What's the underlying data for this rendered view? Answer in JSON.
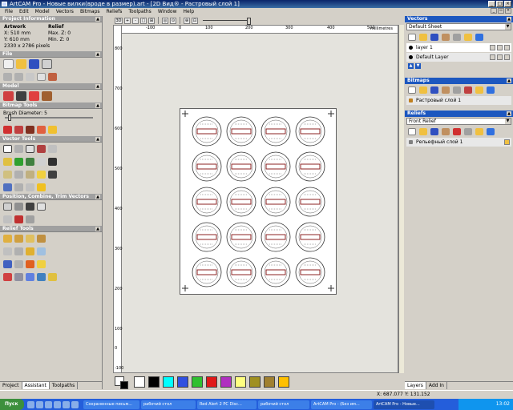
{
  "window": {
    "title": "ArtCAM Pro - Новые вилки(вроде в размер).art - [2D Вид® - Растровый слой 1]",
    "menu": [
      "File",
      "Edit",
      "Model",
      "Vectors",
      "Bitmaps",
      "Reliefs",
      "Toolpaths",
      "Window",
      "Help"
    ]
  },
  "left": {
    "project_info": {
      "header": "Project Information",
      "artwork_label": "Artwork",
      "relief_label": "Relief",
      "x": "X: 510 mm",
      "y": "Y: 610 mm",
      "pixels": "2330 x 2786 pixels",
      "max_z": "Max. Z: 0",
      "min_z": "Min. Z: 0"
    },
    "file_header": "File",
    "model_header": "Model",
    "bitmap_tools_header": "Bitmap Tools",
    "brush_label": "Brush Diameter:",
    "brush_value": "5",
    "vector_tools_header": "Vector Tools",
    "position_header": "Position, Combine, Trim Vectors",
    "relief_tools_header": "Relief Tools",
    "tabs": [
      "Project",
      "Assistant",
      "Toolpaths"
    ]
  },
  "toolbar": {
    "view_2d": "3D",
    "zoom_level": ""
  },
  "ruler": {
    "h_labels": [
      "-100",
      "0",
      "100",
      "200",
      "300",
      "400",
      "500"
    ],
    "v_labels": [
      "800",
      "700",
      "600",
      "500",
      "400",
      "300",
      "200",
      "100",
      "0",
      "-100"
    ],
    "units": "millimetres"
  },
  "palette": {
    "colors": [
      "#ffffff",
      "#000000",
      "#00ffff",
      "#3050e0",
      "#30c030",
      "#e01818",
      "#b030c0",
      "#ffff80",
      "#a09020",
      "#a08030",
      "#ffc000"
    ]
  },
  "right": {
    "vectors_header": "Vectors",
    "vectors_sheet": "Default Sheet",
    "layers": [
      "layer 1",
      "Default Layer"
    ],
    "bitmaps_header": "Bitmaps",
    "bitmap_layer": "Растровый слой 1",
    "reliefs_header": "Reliefs",
    "reliefs_dropdown": "Front Relief",
    "relief_layer": "Рельефный слой 1",
    "tabs": [
      "Layers",
      "Add In"
    ]
  },
  "status": {
    "x": "X: 687.077",
    "y": "Y: 131.152"
  },
  "taskbar": {
    "start": "Пуск",
    "tasks": [
      "Сохраненные письм...",
      "рабочий стол",
      "Red Alert 2 PC Disc...",
      "рабочий стол",
      "ArtCAM Pro - (Без им...",
      "ArtCAM Pro - Новые..."
    ],
    "clock": "13:02"
  }
}
